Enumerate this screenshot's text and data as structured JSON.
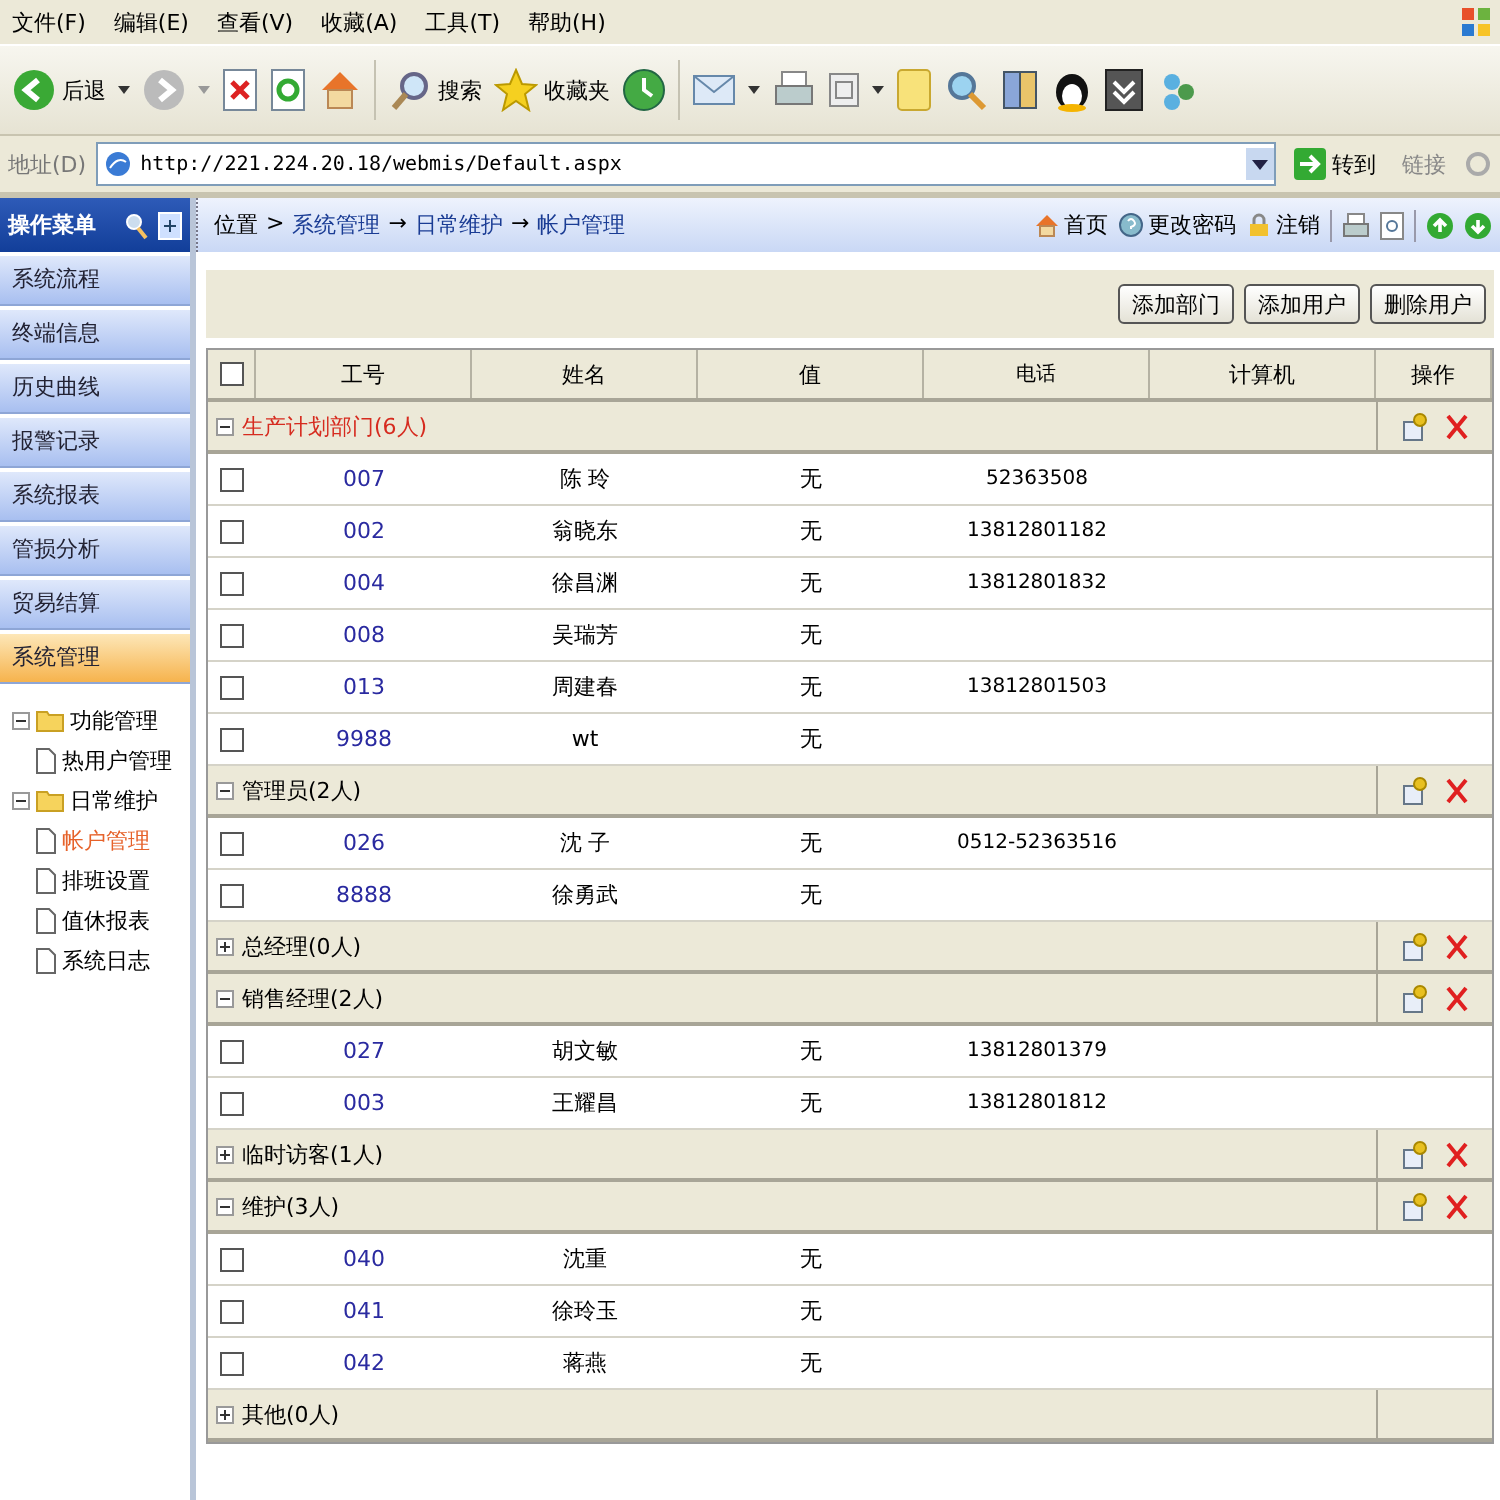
{
  "menu_bar": [
    "文件(F)",
    "编辑(E)",
    "查看(V)",
    "收藏(A)",
    "工具(T)",
    "帮助(H)"
  ],
  "toolbar": {
    "back": "后退",
    "search": "搜索",
    "favorites": "收藏夹"
  },
  "address_bar": {
    "label": "地址(D)",
    "value": "http://221.224.20.18/webmis/Default.aspx",
    "go": "转到",
    "links": "链接"
  },
  "sidebar": {
    "title": "操作菜单",
    "items": [
      {
        "label": "系统流程",
        "selected": false
      },
      {
        "label": "终端信息",
        "selected": false
      },
      {
        "label": "历史曲线",
        "selected": false
      },
      {
        "label": "报警记录",
        "selected": false
      },
      {
        "label": "系统报表",
        "selected": false
      },
      {
        "label": "管损分析",
        "selected": false
      },
      {
        "label": "贸易结算",
        "selected": false
      },
      {
        "label": "系统管理",
        "selected": true
      }
    ],
    "tree": [
      {
        "label": "功能管理",
        "expanded": true,
        "children": [
          {
            "label": "热用户管理",
            "selected": false
          }
        ]
      },
      {
        "label": "日常维护",
        "expanded": true,
        "children": [
          {
            "label": "帐户管理",
            "selected": true
          },
          {
            "label": "排班设置",
            "selected": false
          },
          {
            "label": "值休报表",
            "selected": false
          },
          {
            "label": "系统日志",
            "selected": false
          }
        ]
      }
    ]
  },
  "breadcrumb": [
    {
      "text": "位置"
    },
    {
      "sep": ">",
      "text": "系统管理"
    },
    {
      "sep": "→",
      "text": "日常维护"
    },
    {
      "sep": "→",
      "text": "帐户管理"
    }
  ],
  "header_links": [
    {
      "kind": "home",
      "text": "首页"
    },
    {
      "kind": "password",
      "text": "更改密码"
    },
    {
      "kind": "logout",
      "text": "注销"
    }
  ],
  "actions": [
    "添加部门",
    "添加用户",
    "删除用户"
  ],
  "table": {
    "columns": [
      "工号",
      "姓名",
      "值",
      "电话",
      "计算机",
      "操作"
    ],
    "header_checked": false,
    "groups": [
      {
        "label": "生产计划部门(6人)",
        "expanded": true,
        "selected": true,
        "has_actions": true,
        "rows": [
          {
            "checked": false,
            "id": "007",
            "name": "陈 玲",
            "value": "无",
            "phone": "52363508"
          },
          {
            "checked": false,
            "id": "002",
            "name": "翁晓东",
            "value": "无",
            "phone": "13812801182"
          },
          {
            "checked": false,
            "id": "004",
            "name": "徐昌渊",
            "value": "无",
            "phone": "13812801832"
          },
          {
            "checked": false,
            "id": "008",
            "name": "吴瑞芳",
            "value": "无"
          },
          {
            "checked": false,
            "id": "013",
            "name": "周建春",
            "value": "无",
            "phone": "13812801503"
          },
          {
            "checked": false,
            "id": "9988",
            "name": "wt",
            "value": "无"
          }
        ]
      },
      {
        "label": "管理员(2人)",
        "expanded": true,
        "selected": false,
        "has_actions": true,
        "rows": [
          {
            "checked": false,
            "id": "026",
            "name": "沈 子",
            "value": "无",
            "phone": "0512-52363516"
          },
          {
            "checked": false,
            "id": "8888",
            "name": "徐勇武",
            "value": "无"
          }
        ]
      },
      {
        "label": "总经理(0人)",
        "expanded": false,
        "selected": false,
        "has_actions": true
      },
      {
        "label": "销售经理(2人)",
        "expanded": true,
        "selected": false,
        "has_actions": true,
        "rows": [
          {
            "checked": false,
            "id": "027",
            "name": "胡文敏",
            "value": "无",
            "phone": "13812801379"
          },
          {
            "checked": false,
            "id": "003",
            "name": "王耀昌",
            "value": "无",
            "phone": "13812801812"
          }
        ]
      },
      {
        "label": "临时访客(1人)",
        "expanded": false,
        "selected": false,
        "has_actions": true
      },
      {
        "label": "维护(3人)",
        "expanded": true,
        "selected": false,
        "has_actions": true,
        "rows": [
          {
            "checked": false,
            "id": "040",
            "name": "沈重",
            "value": "无"
          },
          {
            "checked": false,
            "id": "041",
            "name": "徐玲玉",
            "value": "无"
          },
          {
            "checked": false,
            "id": "042",
            "name": "蒋燕",
            "value": "无"
          }
        ]
      },
      {
        "label": "其他(0人)",
        "expanded": false,
        "selected": false,
        "has_actions": false
      }
    ]
  }
}
